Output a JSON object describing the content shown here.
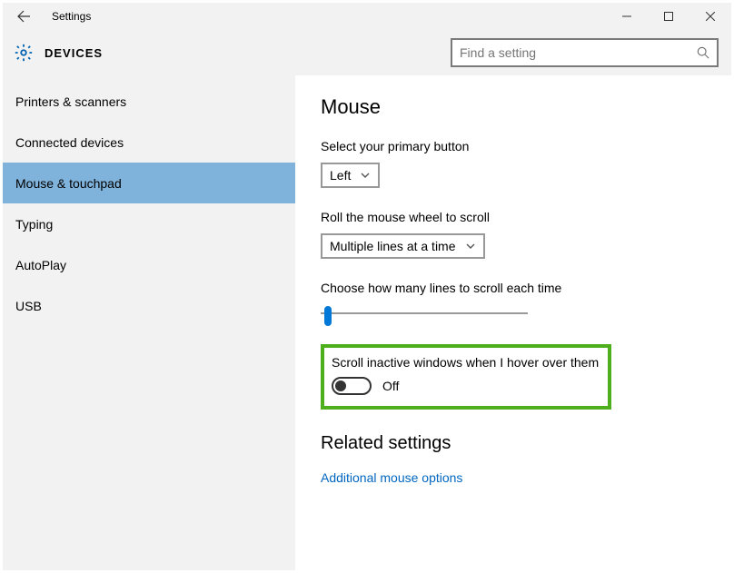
{
  "titlebar": {
    "title": "Settings"
  },
  "header": {
    "category": "DEVICES",
    "search_placeholder": "Find a setting"
  },
  "sidebar": {
    "items": [
      {
        "label": "Printers & scanners",
        "active": false
      },
      {
        "label": "Connected devices",
        "active": false
      },
      {
        "label": "Mouse & touchpad",
        "active": true
      },
      {
        "label": "Typing",
        "active": false
      },
      {
        "label": "AutoPlay",
        "active": false
      },
      {
        "label": "USB",
        "active": false
      }
    ]
  },
  "content": {
    "heading": "Mouse",
    "primary_button_label": "Select your primary button",
    "primary_button_value": "Left",
    "wheel_label": "Roll the mouse wheel to scroll",
    "wheel_value": "Multiple lines at a time",
    "lines_label": "Choose how many lines to scroll each time",
    "inactive_label": "Scroll inactive windows when I hover over them",
    "inactive_state": "Off",
    "related_heading": "Related settings",
    "related_link": "Additional mouse options"
  }
}
